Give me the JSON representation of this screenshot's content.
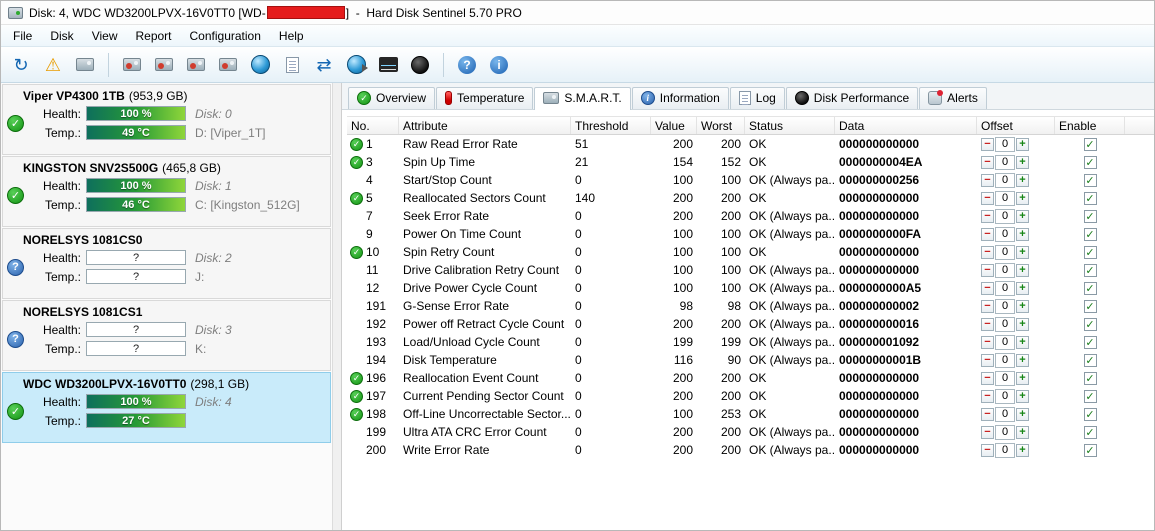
{
  "window": {
    "title_prefix": "Disk: 4, WDC WD3200LPVX-16V0TT0 [WD-",
    "title_suffix": "]  -  Hard Disk Sentinel 5.70 PRO"
  },
  "menu": {
    "items": [
      "File",
      "Disk",
      "View",
      "Report",
      "Configuration",
      "Help"
    ]
  },
  "toolbar": {
    "buttons": [
      {
        "name": "refresh",
        "icon": "refresh"
      },
      {
        "name": "scheduled-problems",
        "icon": "warning"
      },
      {
        "name": "eject-disk",
        "icon": "disk"
      },
      {
        "type": "separator"
      },
      {
        "name": "disk-acoustic",
        "icon": "disk-tool"
      },
      {
        "name": "disk-apm",
        "icon": "disk-tool"
      },
      {
        "name": "disk-spindown",
        "icon": "disk-tool"
      },
      {
        "name": "disk-standby",
        "icon": "disk-tool"
      },
      {
        "name": "online-update",
        "icon": "globe"
      },
      {
        "name": "report",
        "icon": "document"
      },
      {
        "name": "refresh-information",
        "icon": "sync"
      },
      {
        "name": "speech-status",
        "icon": "globe-speaker"
      },
      {
        "name": "performance-graph",
        "icon": "graph"
      },
      {
        "name": "surface-test",
        "icon": "dark-disk"
      },
      {
        "type": "separator"
      },
      {
        "name": "help",
        "icon": "help-circle"
      },
      {
        "name": "about",
        "icon": "info-circle"
      }
    ]
  },
  "sidebar": {
    "health_label": "Health:",
    "temp_label": "Temp.:",
    "disks": [
      {
        "name": "Viper VP4300 1TB",
        "size": "(953,9 GB)",
        "state": "ok",
        "health": "100 %",
        "temp": "49 °C",
        "disk_no": "Disk: 0",
        "drive": "D: [Viper_1T]",
        "selected": false
      },
      {
        "name": "KINGSTON SNV2S500G",
        "size": "(465,8 GB)",
        "state": "ok",
        "health": "100 %",
        "temp": "46 °C",
        "disk_no": "Disk: 1",
        "drive": "C: [Kingston_512G]",
        "selected": false
      },
      {
        "name": "NORELSYS 1081CS0",
        "size": "",
        "state": "unknown",
        "health": "?",
        "temp": "?",
        "disk_no": "Disk: 2",
        "drive": "J:",
        "selected": false
      },
      {
        "name": "NORELSYS 1081CS1",
        "size": "",
        "state": "unknown",
        "health": "?",
        "temp": "?",
        "disk_no": "Disk: 3",
        "drive": "K:",
        "selected": false
      },
      {
        "name": "WDC WD3200LPVX-16V0TT0",
        "size": "(298,1 GB)",
        "state": "ok",
        "health": "100 %",
        "temp": "27 °C",
        "disk_no": "Disk: 4",
        "drive": "",
        "selected": true
      }
    ]
  },
  "tabs": {
    "items": [
      {
        "label": "Overview",
        "icon": "check",
        "active": false
      },
      {
        "label": "Temperature",
        "icon": "thermometer",
        "active": false
      },
      {
        "label": "S.M.A.R.T.",
        "icon": "disk",
        "active": true
      },
      {
        "label": "Information",
        "icon": "info",
        "active": false
      },
      {
        "label": "Log",
        "icon": "document",
        "active": false
      },
      {
        "label": "Disk Performance",
        "icon": "dark-disk",
        "active": false
      },
      {
        "label": "Alerts",
        "icon": "alert",
        "active": false
      }
    ]
  },
  "table": {
    "headers": [
      "No.",
      "Attribute",
      "Threshold",
      "Value",
      "Worst",
      "Status",
      "Data",
      "Offset",
      "Enable"
    ],
    "rows": [
      {
        "ok": true,
        "no": "1",
        "attribute": "Raw Read Error Rate",
        "threshold": "51",
        "value": "200",
        "worst": "200",
        "status": "OK",
        "data": "000000000000",
        "offset": "0",
        "enabled": true
      },
      {
        "ok": true,
        "no": "3",
        "attribute": "Spin Up Time",
        "threshold": "21",
        "value": "154",
        "worst": "152",
        "status": "OK",
        "data": "0000000004EA",
        "offset": "0",
        "enabled": true
      },
      {
        "ok": false,
        "no": "4",
        "attribute": "Start/Stop Count",
        "threshold": "0",
        "value": "100",
        "worst": "100",
        "status": "OK (Always pa...",
        "data": "000000000256",
        "offset": "0",
        "enabled": true
      },
      {
        "ok": true,
        "no": "5",
        "attribute": "Reallocated Sectors Count",
        "threshold": "140",
        "value": "200",
        "worst": "200",
        "status": "OK",
        "data": "000000000000",
        "offset": "0",
        "enabled": true
      },
      {
        "ok": false,
        "no": "7",
        "attribute": "Seek Error Rate",
        "threshold": "0",
        "value": "200",
        "worst": "200",
        "status": "OK (Always pa...",
        "data": "000000000000",
        "offset": "0",
        "enabled": true
      },
      {
        "ok": false,
        "no": "9",
        "attribute": "Power On Time Count",
        "threshold": "0",
        "value": "100",
        "worst": "100",
        "status": "OK (Always pa...",
        "data": "0000000000FA",
        "offset": "0",
        "enabled": true
      },
      {
        "ok": true,
        "no": "10",
        "attribute": "Spin Retry Count",
        "threshold": "0",
        "value": "100",
        "worst": "100",
        "status": "OK",
        "data": "000000000000",
        "offset": "0",
        "enabled": true
      },
      {
        "ok": false,
        "no": "11",
        "attribute": "Drive Calibration Retry Count",
        "threshold": "0",
        "value": "100",
        "worst": "100",
        "status": "OK (Always pa...",
        "data": "000000000000",
        "offset": "0",
        "enabled": true
      },
      {
        "ok": false,
        "no": "12",
        "attribute": "Drive Power Cycle Count",
        "threshold": "0",
        "value": "100",
        "worst": "100",
        "status": "OK (Always pa...",
        "data": "0000000000A5",
        "offset": "0",
        "enabled": true
      },
      {
        "ok": false,
        "no": "191",
        "attribute": "G-Sense Error Rate",
        "threshold": "0",
        "value": "98",
        "worst": "98",
        "status": "OK (Always pa...",
        "data": "000000000002",
        "offset": "0",
        "enabled": true
      },
      {
        "ok": false,
        "no": "192",
        "attribute": "Power off Retract Cycle Count",
        "threshold": "0",
        "value": "200",
        "worst": "200",
        "status": "OK (Always pa...",
        "data": "000000000016",
        "offset": "0",
        "enabled": true
      },
      {
        "ok": false,
        "no": "193",
        "attribute": "Load/Unload Cycle Count",
        "threshold": "0",
        "value": "199",
        "worst": "199",
        "status": "OK (Always pa...",
        "data": "000000001092",
        "offset": "0",
        "enabled": true
      },
      {
        "ok": false,
        "no": "194",
        "attribute": "Disk Temperature",
        "threshold": "0",
        "value": "116",
        "worst": "90",
        "status": "OK (Always pa...",
        "data": "00000000001B",
        "offset": "0",
        "enabled": true
      },
      {
        "ok": true,
        "no": "196",
        "attribute": "Reallocation Event Count",
        "threshold": "0",
        "value": "200",
        "worst": "200",
        "status": "OK",
        "data": "000000000000",
        "offset": "0",
        "enabled": true
      },
      {
        "ok": true,
        "no": "197",
        "attribute": "Current Pending Sector Count",
        "threshold": "0",
        "value": "200",
        "worst": "200",
        "status": "OK",
        "data": "000000000000",
        "offset": "0",
        "enabled": true
      },
      {
        "ok": true,
        "no": "198",
        "attribute": "Off-Line Uncorrectable Sector...",
        "threshold": "0",
        "value": "100",
        "worst": "253",
        "status": "OK",
        "data": "000000000000",
        "offset": "0",
        "enabled": true
      },
      {
        "ok": false,
        "no": "199",
        "attribute": "Ultra ATA CRC Error Count",
        "threshold": "0",
        "value": "200",
        "worst": "200",
        "status": "OK (Always pa...",
        "data": "000000000000",
        "offset": "0",
        "enabled": true
      },
      {
        "ok": false,
        "no": "200",
        "attribute": "Write Error Rate",
        "threshold": "0",
        "value": "200",
        "worst": "200",
        "status": "OK (Always pa...",
        "data": "000000000000",
        "offset": "0",
        "enabled": true
      }
    ]
  },
  "colors": {
    "selected_panel": "#c9ebfa",
    "health_bar_gradient": [
      "#0e6f5c",
      "#279a36",
      "#8fd63a"
    ],
    "ok_green": "#149414",
    "unknown_blue": "#2a62ad",
    "redacted_red": "#e51c1c"
  }
}
